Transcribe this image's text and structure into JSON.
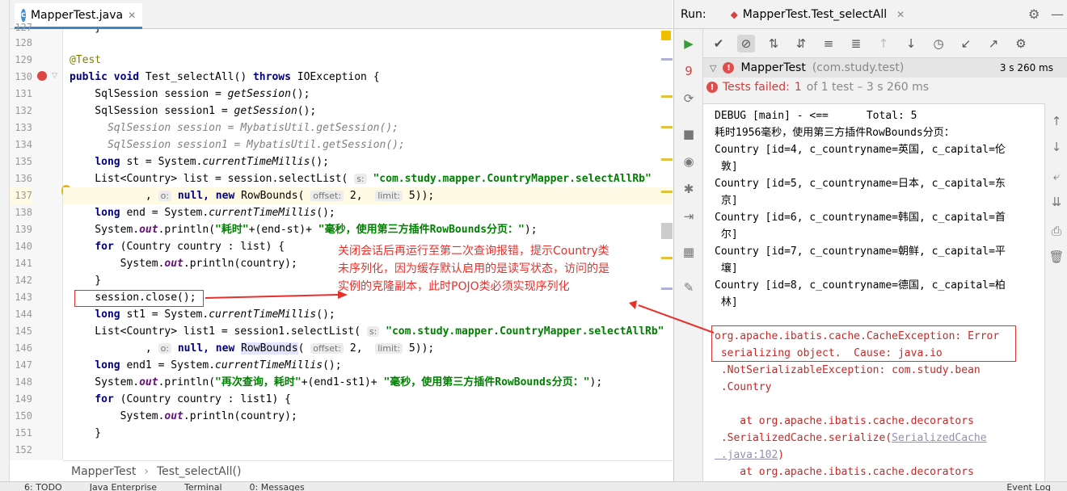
{
  "colors": {
    "accent": "#4083c9",
    "error": "#c6403d",
    "annotation": "#e8302b"
  },
  "editor": {
    "tab_label": "MapperTest.java",
    "tab_icon": "class-file-icon",
    "breadcrumb": [
      "MapperTest",
      "Test_selectAll()"
    ]
  },
  "lines": {
    "n127": "127",
    "n128": "128",
    "n129": "129",
    "n130": "130",
    "n131": "131",
    "n132": "132",
    "n133": "133",
    "n134": "134",
    "n135": "135",
    "n136": "136",
    "n137": "137",
    "n138": "138",
    "n139": "139",
    "n140": "140",
    "n141": "141",
    "n142": "142",
    "n143": "143",
    "n144": "144",
    "n145": "145",
    "n146": "146",
    "n147": "147",
    "n148": "148",
    "n149": "149",
    "n150": "150",
    "n151": "151",
    "n152": "152"
  },
  "code": {
    "l127": "    }",
    "l129_ann": "@Test",
    "l130_kw1": "public void ",
    "l130_name": "Test_selectAll() ",
    "l130_kw2": "throws ",
    "l130_rest": "IOException {",
    "l131a": "    SqlSession session = ",
    "l131b": "getSession",
    "l131c": "();",
    "l132a": "    SqlSession session1 = ",
    "l132b": "getSession",
    "l132c": "();",
    "l133": "      SqlSession session = MybatisUtil.getSession();",
    "l134": "      SqlSession session1 = MybatisUtil.getSession();",
    "l135a": "    ",
    "l135kw": "long ",
    "l135b": "st = System.",
    "l135c": "currentTimeMillis",
    "l135d": "();",
    "l136a": "    List<Country> list = session.selectList( ",
    "l136hint": "s:",
    "l136str": " \"com.study.mapper.CountryMapper.selectAllRb\"",
    "l137a": "            , ",
    "l137hint1": "o:",
    "l137kw": " null, new ",
    "l137cls": "RowBounds",
    "l137b": "( ",
    "l137hint2": "offset:",
    "l137c": " 2,  ",
    "l137hint3": "limit:",
    "l137d": " 5));",
    "l138a": "    ",
    "l138kw": "long ",
    "l138b": "end = System.",
    "l138c": "currentTimeMillis",
    "l138d": "();",
    "l139a": "    System.",
    "l139out": "out",
    "l139b": ".println(",
    "l139str1": "\"耗时\"",
    "l139c": "+(end-st)+ ",
    "l139str2": "\"毫秒，使用第三方插件RowBounds分页：\"",
    "l139d": ");",
    "l140a": "    ",
    "l140kw": "for ",
    "l140b": "(Country country : list) {",
    "l141a": "        System.",
    "l141out": "out",
    "l141b": ".println(country);",
    "l142": "    }",
    "l143": "    session.close();",
    "l144a": "    ",
    "l144kw": "long ",
    "l144b": "st1 = System.",
    "l144c": "currentTimeMillis",
    "l144d": "();",
    "l145a": "    List<Country> list1 = session1.selectList( ",
    "l145hint": "s:",
    "l145str": " \"com.study.mapper.CountryMapper.selectAllRb\"",
    "l146a": "            , ",
    "l146hint1": "o:",
    "l146kw": " null, new ",
    "l146cls": "RowBounds",
    "l146b": "( ",
    "l146hint2": "offset:",
    "l146c": " 2,  ",
    "l146hint3": "limit:",
    "l146d": " 5));",
    "l147a": "    ",
    "l147kw": "long ",
    "l147b": "end1 = System.",
    "l147c": "currentTimeMillis",
    "l147d": "();",
    "l148a": "    System.",
    "l148out": "out",
    "l148b": ".println(",
    "l148str1": "\"再次查询，耗时\"",
    "l148c": "+(end1-st1)+ ",
    "l148str2": "\"毫秒，使用第三方插件RowBounds分页：\"",
    "l148d": ");",
    "l149a": "    ",
    "l149kw": "for ",
    "l149b": "(Country country : list1) {",
    "l150a": "        System.",
    "l150out": "out",
    "l150b": ".println(country);",
    "l151": "    }"
  },
  "annotation_note": {
    "line1": "关闭会话后再运行至第二次查询报错，提示Country类",
    "line2": "未序列化，因为缓存默认启用的是读写状态，访问的是",
    "line3": "实例的克隆副本，此时POJO类必须实现序列化"
  },
  "run": {
    "label": "Run:",
    "config_name": "MapperTest.Test_selectAll",
    "tree_class": "MapperTest",
    "tree_package": "(com.study.test)",
    "tree_time": "3 s 260 ms",
    "fail_label": "Tests failed:",
    "fail_count": "1",
    "fail_rest": "of 1 test – 3 s 260 ms",
    "badge_count": "9"
  },
  "console": {
    "c1": "DEBUG [main] - <==      Total: 5",
    "c2": "耗时1956毫秒，使用第三方插件RowBounds分页：",
    "c3": "Country [id=4, c_countryname=英国, c_capital=伦",
    "c4": " 敦]",
    "c5": "Country [id=5, c_countryname=日本, c_capital=东",
    "c6": " 京]",
    "c7": "Country [id=6, c_countryname=韩国, c_capital=首",
    "c8": " 尔]",
    "c9": "Country [id=7, c_countryname=朝鲜, c_capital=平",
    "c10": " 壤]",
    "c11": "Country [id=8, c_countryname=德国, c_capital=柏",
    "c12": " 林]",
    "e1": "org.apache.ibatis.cache.CacheException: Error",
    "e2": " serializing object.  Cause: java.io",
    "e3": " .NotSerializableException: com.study.bean",
    "e4": " .Country",
    "e5": "    at org.apache.ibatis.cache.decorators",
    "e6": " .SerializedCache.serialize(",
    "e6link": "SerializedCache",
    "e7link": " .java:102",
    "e7": ")",
    "e8": "    at org.apache.ibatis.cache.decorators"
  },
  "bottom": {
    "todo": "6: TODO",
    "problems": "Java Enterprise",
    "terminal": "Terminal",
    "messages": "0: Messages",
    "event": "Event Log"
  }
}
